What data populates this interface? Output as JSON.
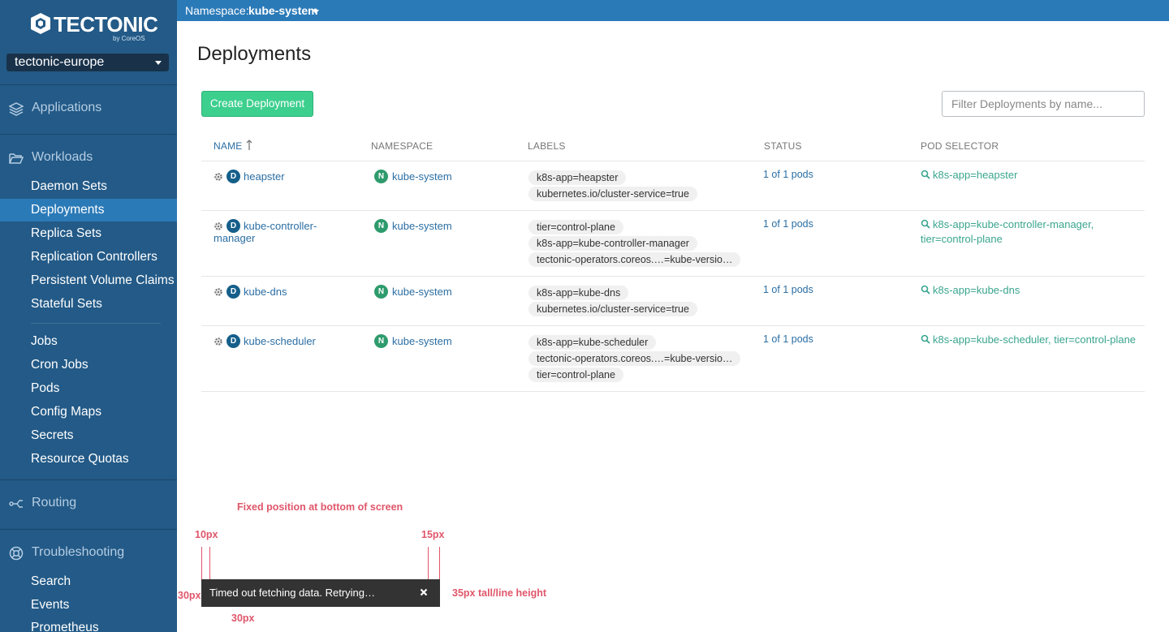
{
  "app": {
    "brand": "TECTONIC",
    "by": "by CoreOS",
    "cluster": "tectonic-europe"
  },
  "topbar": {
    "namespace_label": "Namespace:",
    "namespace_value": "kube-system"
  },
  "sidebar": {
    "sections": [
      {
        "label": "Applications",
        "icon": "layers-icon"
      },
      {
        "label": "Workloads",
        "icon": "folder-open-icon"
      },
      {
        "label": "Routing",
        "icon": "routing-icon"
      },
      {
        "label": "Troubleshooting",
        "icon": "lifebuoy-icon"
      }
    ],
    "workloads": [
      "Daemon Sets",
      "Deployments",
      "Replica Sets",
      "Replication Controllers",
      "Persistent Volume Claims",
      "Stateful Sets"
    ],
    "workloads_more": [
      "Jobs",
      "Cron Jobs",
      "Pods",
      "Config Maps",
      "Secrets",
      "Resource Quotas"
    ],
    "troubleshooting": [
      "Search",
      "Events",
      "Prometheus"
    ],
    "active": "Deployments"
  },
  "page": {
    "title": "Deployments",
    "create_button": "Create Deployment",
    "filter_placeholder": "Filter Deployments by name..."
  },
  "table": {
    "columns": [
      "NAME",
      "NAMESPACE",
      "LABELS",
      "STATUS",
      "POD SELECTOR"
    ],
    "rows": [
      {
        "kind": "D",
        "name": "heapster",
        "ns_kind": "N",
        "namespace": "kube-system",
        "labels": [
          "k8s-app=heapster",
          "kubernetes.io/cluster-service=true"
        ],
        "status": "1 of 1 pods",
        "selector": "k8s-app=heapster"
      },
      {
        "kind": "D",
        "name": "kube-controller-manager",
        "ns_kind": "N",
        "namespace": "kube-system",
        "labels": [
          "tier=control-plane",
          "k8s-app=kube-controller-manager",
          "tectonic-operators.coreos.…=kube-versio…"
        ],
        "status": "1 of 1 pods",
        "selector": "k8s-app=kube-controller-manager, tier=control-plane"
      },
      {
        "kind": "D",
        "name": "kube-dns",
        "ns_kind": "N",
        "namespace": "kube-system",
        "labels": [
          "k8s-app=kube-dns",
          "kubernetes.io/cluster-service=true"
        ],
        "status": "1 of 1 pods",
        "selector": "k8s-app=kube-dns"
      },
      {
        "kind": "D",
        "name": "kube-scheduler",
        "ns_kind": "N",
        "namespace": "kube-system",
        "labels": [
          "k8s-app=kube-scheduler",
          "tectonic-operators.coreos.…=kube-versio…",
          "tier=control-plane"
        ],
        "status": "1 of 1 pods",
        "selector": "k8s-app=kube-scheduler, tier=control-plane"
      }
    ]
  },
  "annotations": {
    "fixed": "Fixed position at bottom of screen",
    "left_pad": "10px",
    "right_pad": "15px",
    "left_offset": "30px",
    "bottom_offset": "30px",
    "height": "35px tall/line height"
  },
  "toast": {
    "message": "Timed out fetching data. Retrying…"
  },
  "colors": {
    "sidebar": "#235a87",
    "active": "#2b7ab8",
    "create": "#3dcf8e",
    "link": "#2b6ea3",
    "selector": "#3aa58f",
    "annotation": "#e0566a"
  }
}
